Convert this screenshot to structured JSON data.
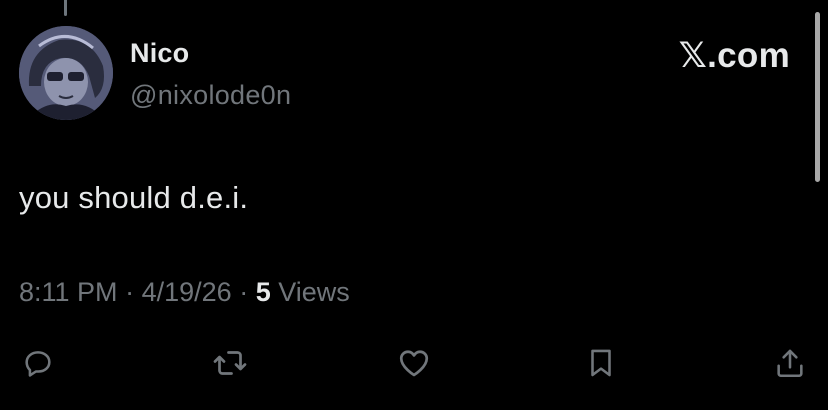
{
  "author": {
    "display_name": "Nico",
    "handle": "@nixolode0n"
  },
  "brand": {
    "label": "𝕏.com"
  },
  "tweet": {
    "text": "you should d.e.i.",
    "time": "8:11 PM",
    "date": "4/19/26",
    "separator": "·",
    "views_count": "5",
    "views_label": "Views"
  },
  "actions": [
    {
      "name": "reply",
      "icon": "reply-icon"
    },
    {
      "name": "retweet",
      "icon": "retweet-icon"
    },
    {
      "name": "like",
      "icon": "heart-icon"
    },
    {
      "name": "bookmark",
      "icon": "bookmark-icon"
    },
    {
      "name": "share",
      "icon": "share-icon"
    }
  ],
  "colors": {
    "background": "#000000",
    "primary_text": "#e7e9ea",
    "secondary_text": "#71767b",
    "icon": "#71767b"
  }
}
